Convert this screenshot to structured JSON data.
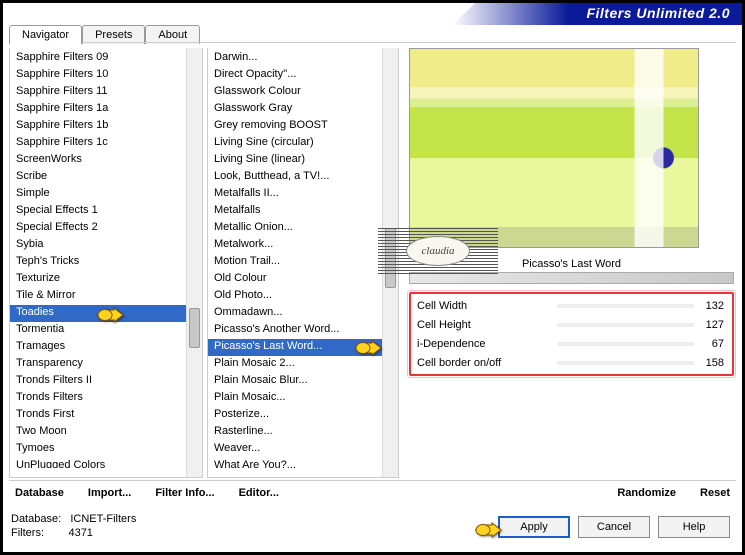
{
  "title": "Filters Unlimited 2.0",
  "tabs": [
    {
      "label": "Navigator",
      "active": true
    },
    {
      "label": "Presets",
      "active": false
    },
    {
      "label": "About",
      "active": false
    }
  ],
  "categories": [
    "Sapphire Filters 09",
    "Sapphire Filters 10",
    "Sapphire Filters 11",
    "Sapphire Filters 1a",
    "Sapphire Filters 1b",
    "Sapphire Filters 1c",
    "ScreenWorks",
    "Scribe",
    "Simple",
    "Special Effects 1",
    "Special Effects 2",
    "Sybia",
    "Teph's Tricks",
    "Texturize",
    "Tile & Mirror",
    "Toadies",
    "Tormentia",
    "Tramages",
    "Transparency",
    "Tronds Filters II",
    "Tronds Filters",
    "Tronds First",
    "Two Moon",
    "Tymoes",
    "UnPlugged Colors"
  ],
  "categories_selected": "Toadies",
  "filters": [
    "Darwin...",
    "Direct Opacity''...",
    "Glasswork Colour",
    "Glasswork Gray",
    "Grey removing BOOST",
    "Living Sine (circular)",
    "Living Sine (linear)",
    "Look, Butthead, a TV!...",
    "Metalfalls II...",
    "Metalfalls",
    "Metallic Onion...",
    "Metalwork...",
    "Motion Trail...",
    "Old Colour",
    "Old Photo...",
    "Ommadawn...",
    "Picasso's Another Word...",
    "Picasso's Last Word...",
    "Plain Mosaic 2...",
    "Plain Mosaic Blur...",
    "Plain Mosaic...",
    "Posterize...",
    "Rasterline...",
    "Weaver...",
    "What Are You?..."
  ],
  "filters_selected": "Picasso's Last Word...",
  "preview_title": "Picasso's Last Word",
  "params": [
    {
      "label": "Cell Width",
      "value": 132
    },
    {
      "label": "Cell Height",
      "value": 127
    },
    {
      "label": "i-Dependence",
      "value": 67
    },
    {
      "label": "Cell border on/off",
      "value": 158
    }
  ],
  "links": {
    "database": "Database",
    "import": "Import...",
    "filterinfo": "Filter Info...",
    "editor": "Editor...",
    "randomize": "Randomize",
    "reset": "Reset"
  },
  "buttons": {
    "apply": "Apply",
    "cancel": "Cancel",
    "help": "Help"
  },
  "status": {
    "db_label": "Database:",
    "db_value": "ICNET-Filters",
    "filters_label": "Filters:",
    "filters_value": "4371"
  },
  "watermark": "claudia"
}
